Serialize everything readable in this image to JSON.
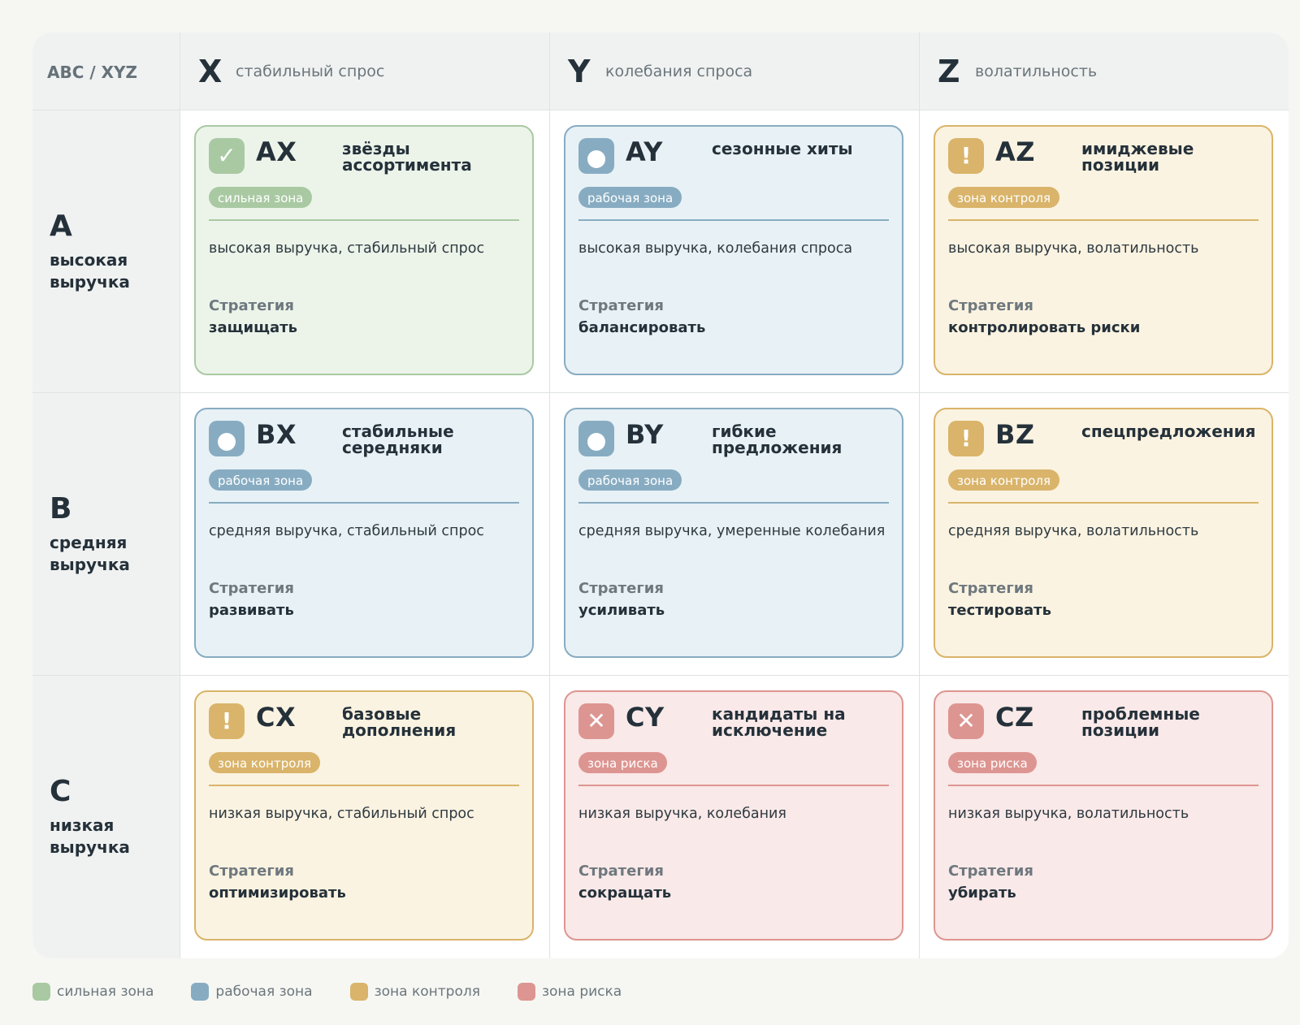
{
  "corner_label": "ABC / XYZ",
  "columns": [
    {
      "letter": "X",
      "sub": "стабильный спрос"
    },
    {
      "letter": "Y",
      "sub": "колебания спроса"
    },
    {
      "letter": "Z",
      "sub": "волатильность"
    }
  ],
  "rows": [
    {
      "letter": "A",
      "sub": "высокая выручка"
    },
    {
      "letter": "B",
      "sub": "средняя выручка"
    },
    {
      "letter": "C",
      "sub": "низкая выручка"
    }
  ],
  "strategy_label": "Стратегия",
  "cells": {
    "AX": {
      "code": "AX",
      "title": "звёзды ассортимента",
      "zone": "сильная зона",
      "icon": "check-icon",
      "desc": "высокая выручка, стабильный спрос",
      "strategy": "защищать"
    },
    "AY": {
      "code": "AY",
      "title": "сезонные хиты",
      "zone": "рабочая зона",
      "icon": "dot-icon",
      "desc": "высокая выручка, колебания спроса",
      "strategy": "балансировать"
    },
    "AZ": {
      "code": "AZ",
      "title": "имиджевые позиции",
      "zone": "зона контроля",
      "icon": "exclamation-icon",
      "desc": "высокая выручка, волатильность",
      "strategy": "контролировать риски"
    },
    "BX": {
      "code": "BX",
      "title": "стабильные середняки",
      "zone": "рабочая зона",
      "icon": "dot-icon",
      "desc": "средняя выручка, стабильный спрос",
      "strategy": "развивать"
    },
    "BY": {
      "code": "BY",
      "title": "гибкие предложения",
      "zone": "рабочая зона",
      "icon": "dot-icon",
      "desc": "средняя выручка, умеренные колебания",
      "strategy": "усиливать"
    },
    "BZ": {
      "code": "BZ",
      "title": "спецпредложения",
      "zone": "зона контроля",
      "icon": "exclamation-icon",
      "desc": "средняя выручка, волатильность",
      "strategy": "тестировать"
    },
    "CX": {
      "code": "CX",
      "title": "базовые дополнения",
      "zone": "зона контроля",
      "icon": "exclamation-icon",
      "desc": "низкая выручка, стабильный спрос",
      "strategy": "оптимизировать"
    },
    "CY": {
      "code": "CY",
      "title": "кандидаты на исключение",
      "zone": "зона риска",
      "icon": "cross-icon",
      "desc": "низкая выручка, колебания",
      "strategy": "сокращать"
    },
    "CZ": {
      "code": "CZ",
      "title": "проблемные позиции",
      "zone": "зона риска",
      "icon": "cross-icon",
      "desc": "низкая выручка, волатильность",
      "strategy": "убирать"
    }
  },
  "legend": [
    {
      "label": "сильная зона",
      "color": "#a9c9a2"
    },
    {
      "label": "рабочая зона",
      "color": "#87acc2"
    },
    {
      "label": "зона контроля",
      "color": "#d9b46a"
    },
    {
      "label": "зона риска",
      "color": "#dd9591"
    }
  ],
  "colors": {
    "strong": "#a9c9a2",
    "work": "#87acc2",
    "control": "#d9b46a",
    "risk": "#dd9591"
  }
}
